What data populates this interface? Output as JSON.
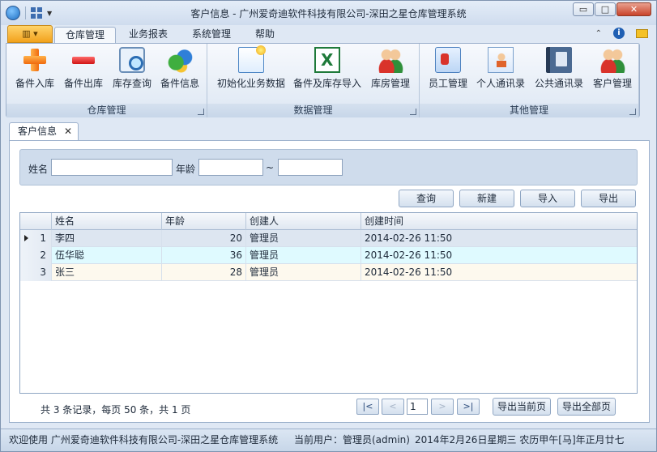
{
  "window": {
    "title": "客户信息 - 广州爱奇迪软件科技有限公司-深田之星仓库管理系统",
    "minimize": "▭",
    "restore": "□",
    "close": "✕"
  },
  "ribbon_tabs": [
    "仓库管理",
    "业务报表",
    "系统管理",
    "帮助"
  ],
  "ribbon_groups": [
    {
      "label": "仓库管理",
      "buttons": [
        {
          "label": "备件入库",
          "icon": "plus-icon"
        },
        {
          "label": "备件出库",
          "icon": "minus-icon"
        },
        {
          "label": "库存查询",
          "icon": "search-doc-icon"
        },
        {
          "label": "备件信息",
          "icon": "parts-icon"
        }
      ]
    },
    {
      "label": "数据管理",
      "buttons": [
        {
          "label": "初始化业务数据",
          "icon": "doc-star-icon"
        },
        {
          "label": "备件及库存导入",
          "icon": "excel-icon"
        },
        {
          "label": "库房管理",
          "icon": "people-icon"
        }
      ]
    },
    {
      "label": "其他管理",
      "buttons": [
        {
          "label": "员工管理",
          "icon": "badge-icon"
        },
        {
          "label": "个人通讯录",
          "icon": "contact-card-icon"
        },
        {
          "label": "公共通讯录",
          "icon": "address-book-icon"
        },
        {
          "label": "客户管理",
          "icon": "people-icon"
        }
      ]
    }
  ],
  "doc_tab": {
    "label": "客户信息",
    "close": "✕"
  },
  "filter": {
    "name_label": "姓名",
    "age_label": "年龄",
    "range_sep": "~",
    "name_value": "",
    "age_from": "",
    "age_to": ""
  },
  "actions": [
    "查询",
    "新建",
    "导入",
    "导出"
  ],
  "table": {
    "columns": [
      "姓名",
      "年龄",
      "创建人",
      "创建时间"
    ],
    "rows": [
      {
        "idx": "1",
        "name": "李四",
        "age": "20",
        "creator": "管理员",
        "created": "2014-02-26 11:50"
      },
      {
        "idx": "2",
        "name": "伍华聪",
        "age": "36",
        "creator": "管理员",
        "created": "2014-02-26 11:50"
      },
      {
        "idx": "3",
        "name": "张三",
        "age": "28",
        "creator": "管理员",
        "created": "2014-02-26 11:50"
      }
    ]
  },
  "pager": {
    "info": "共 3 条记录，每页 50 条，共 1 页",
    "first": "|<",
    "prev": "<",
    "page": "1",
    "next": ">",
    "last": ">|",
    "export_current": "导出当前页",
    "export_all": "导出全部页"
  },
  "status": {
    "welcome": "欢迎使用 广州爱奇迪软件科技有限公司-深田之星仓库管理系统",
    "user": "当前用户：管理员(admin)",
    "date": "2014年2月26日星期三 农历甲午[马]年正月廿七"
  },
  "colors": {
    "row_selected": "#dde6f1",
    "row_alt": "#dffaff",
    "row_third": "#fdf9ee"
  }
}
